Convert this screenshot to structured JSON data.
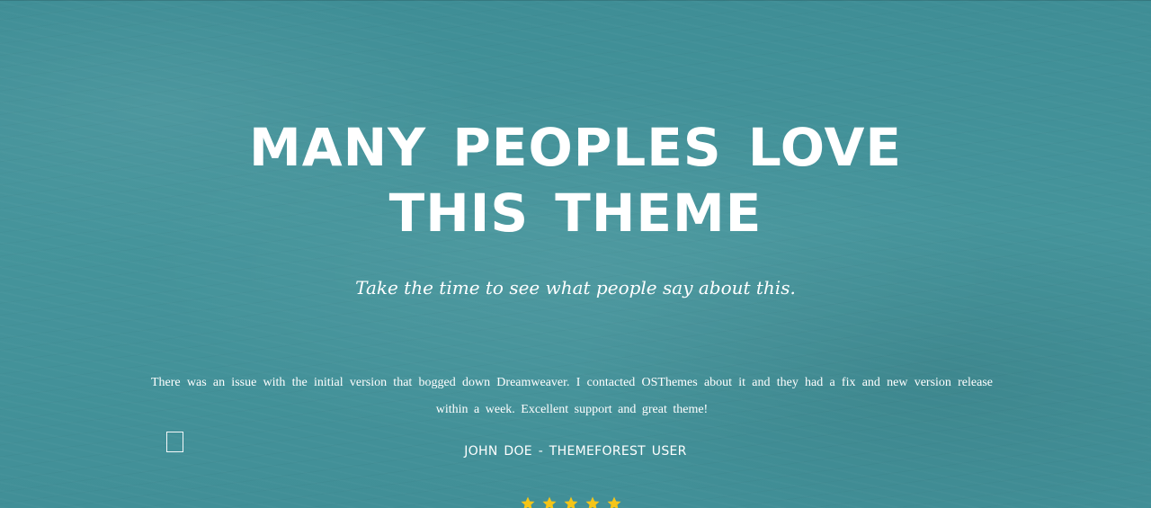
{
  "testimonial_section": {
    "headline": "MANY PEOPLES LOVE THIS THEME",
    "subtitle": "Take the time to see what people say about this.",
    "testimonial": {
      "quote": "There was an issue with the initial version that bogged down Dreamweaver. I contacted OSThemes about it and they had a fix and new version release within a week. Excellent support and great theme!",
      "author": "JOHN DOE - THEMEFOREST USER",
      "rating": 5
    }
  },
  "colors": {
    "background": "#45949b",
    "text": "#ffffff",
    "star": "#f5c518"
  },
  "icons": {
    "checkbox": "checkbox-icon",
    "star": "star-icon"
  }
}
